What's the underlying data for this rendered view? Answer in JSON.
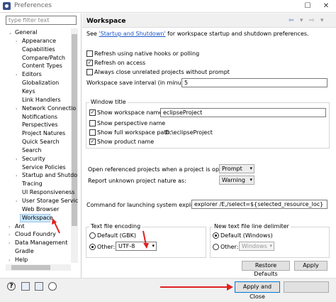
{
  "window": {
    "title": "Preferences"
  },
  "filter": {
    "placeholder": "type filter text"
  },
  "tree": [
    {
      "label": "General",
      "expanded": true
    },
    {
      "label": "Appearance"
    },
    {
      "label": "Capabilities"
    },
    {
      "label": "Compare/Patch"
    },
    {
      "label": "Content Types"
    },
    {
      "label": "Editors"
    },
    {
      "label": "Globalization"
    },
    {
      "label": "Keys"
    },
    {
      "label": "Link Handlers"
    },
    {
      "label": "Network Connectio"
    },
    {
      "label": "Notifications"
    },
    {
      "label": "Perspectives"
    },
    {
      "label": "Project Natures"
    },
    {
      "label": "Quick Search"
    },
    {
      "label": "Search"
    },
    {
      "label": "Security"
    },
    {
      "label": "Service Policies"
    },
    {
      "label": "Startup and Shutdo"
    },
    {
      "label": "Tracing"
    },
    {
      "label": "UI Responsiveness"
    },
    {
      "label": "User Storage Servic"
    },
    {
      "label": "Web Browser"
    },
    {
      "label": "Workspace",
      "selected": true
    },
    {
      "label": "Ant"
    },
    {
      "label": "Cloud Foundry"
    },
    {
      "label": "Data Management"
    },
    {
      "label": "Gradle"
    },
    {
      "label": "Help"
    }
  ],
  "page": {
    "title": "Workspace",
    "see_prefix": "See ",
    "see_link": "'Startup and Shutdown'",
    "see_suffix": " for workspace startup and shutdown preferences.",
    "refresh_native": "Refresh using native hooks or polling",
    "refresh_access": "Refresh on access",
    "always_close": "Always close unrelated projects without prompt",
    "save_interval_label": "Workspace save interval (in minutes):",
    "save_interval_value": "5",
    "window_title_group": "Window title",
    "show_ws_name": "Show workspace name:",
    "ws_name_value": "eclipseProject",
    "show_perspective": "Show perspective name",
    "show_ws_path": "Show full workspace path:",
    "ws_path_value": "D:\\eclipseProject",
    "show_product": "Show product name",
    "open_ref_label": "Open referenced projects when a project is opened:",
    "open_ref_value": "Prompt",
    "report_nature_label": "Report unknown project nature as:",
    "report_nature_value": "Warning",
    "cmd_explorer_label": "Command for launching system explorer:",
    "cmd_explorer_value": "explorer /E,/select=${selected_resource_loc}",
    "encoding_group": "Text file encoding",
    "enc_default": "Default (GBK)",
    "enc_other": "Other:",
    "enc_other_value": "UTF-8",
    "delim_group": "New text file line delimiter",
    "delim_default": "Default (Windows)",
    "delim_other": "Other:",
    "delim_other_value": "Windows",
    "restore_defaults": "Restore Defaults",
    "apply": "Apply"
  },
  "footer": {
    "apply_close": "Apply and Close"
  },
  "nav": {
    "back": "⇦",
    "forward": "⇨",
    "menu": "▾"
  },
  "colors": {
    "accent": "#0078d7",
    "annotation_red": "#e02020",
    "selection": "#cce8ff"
  }
}
